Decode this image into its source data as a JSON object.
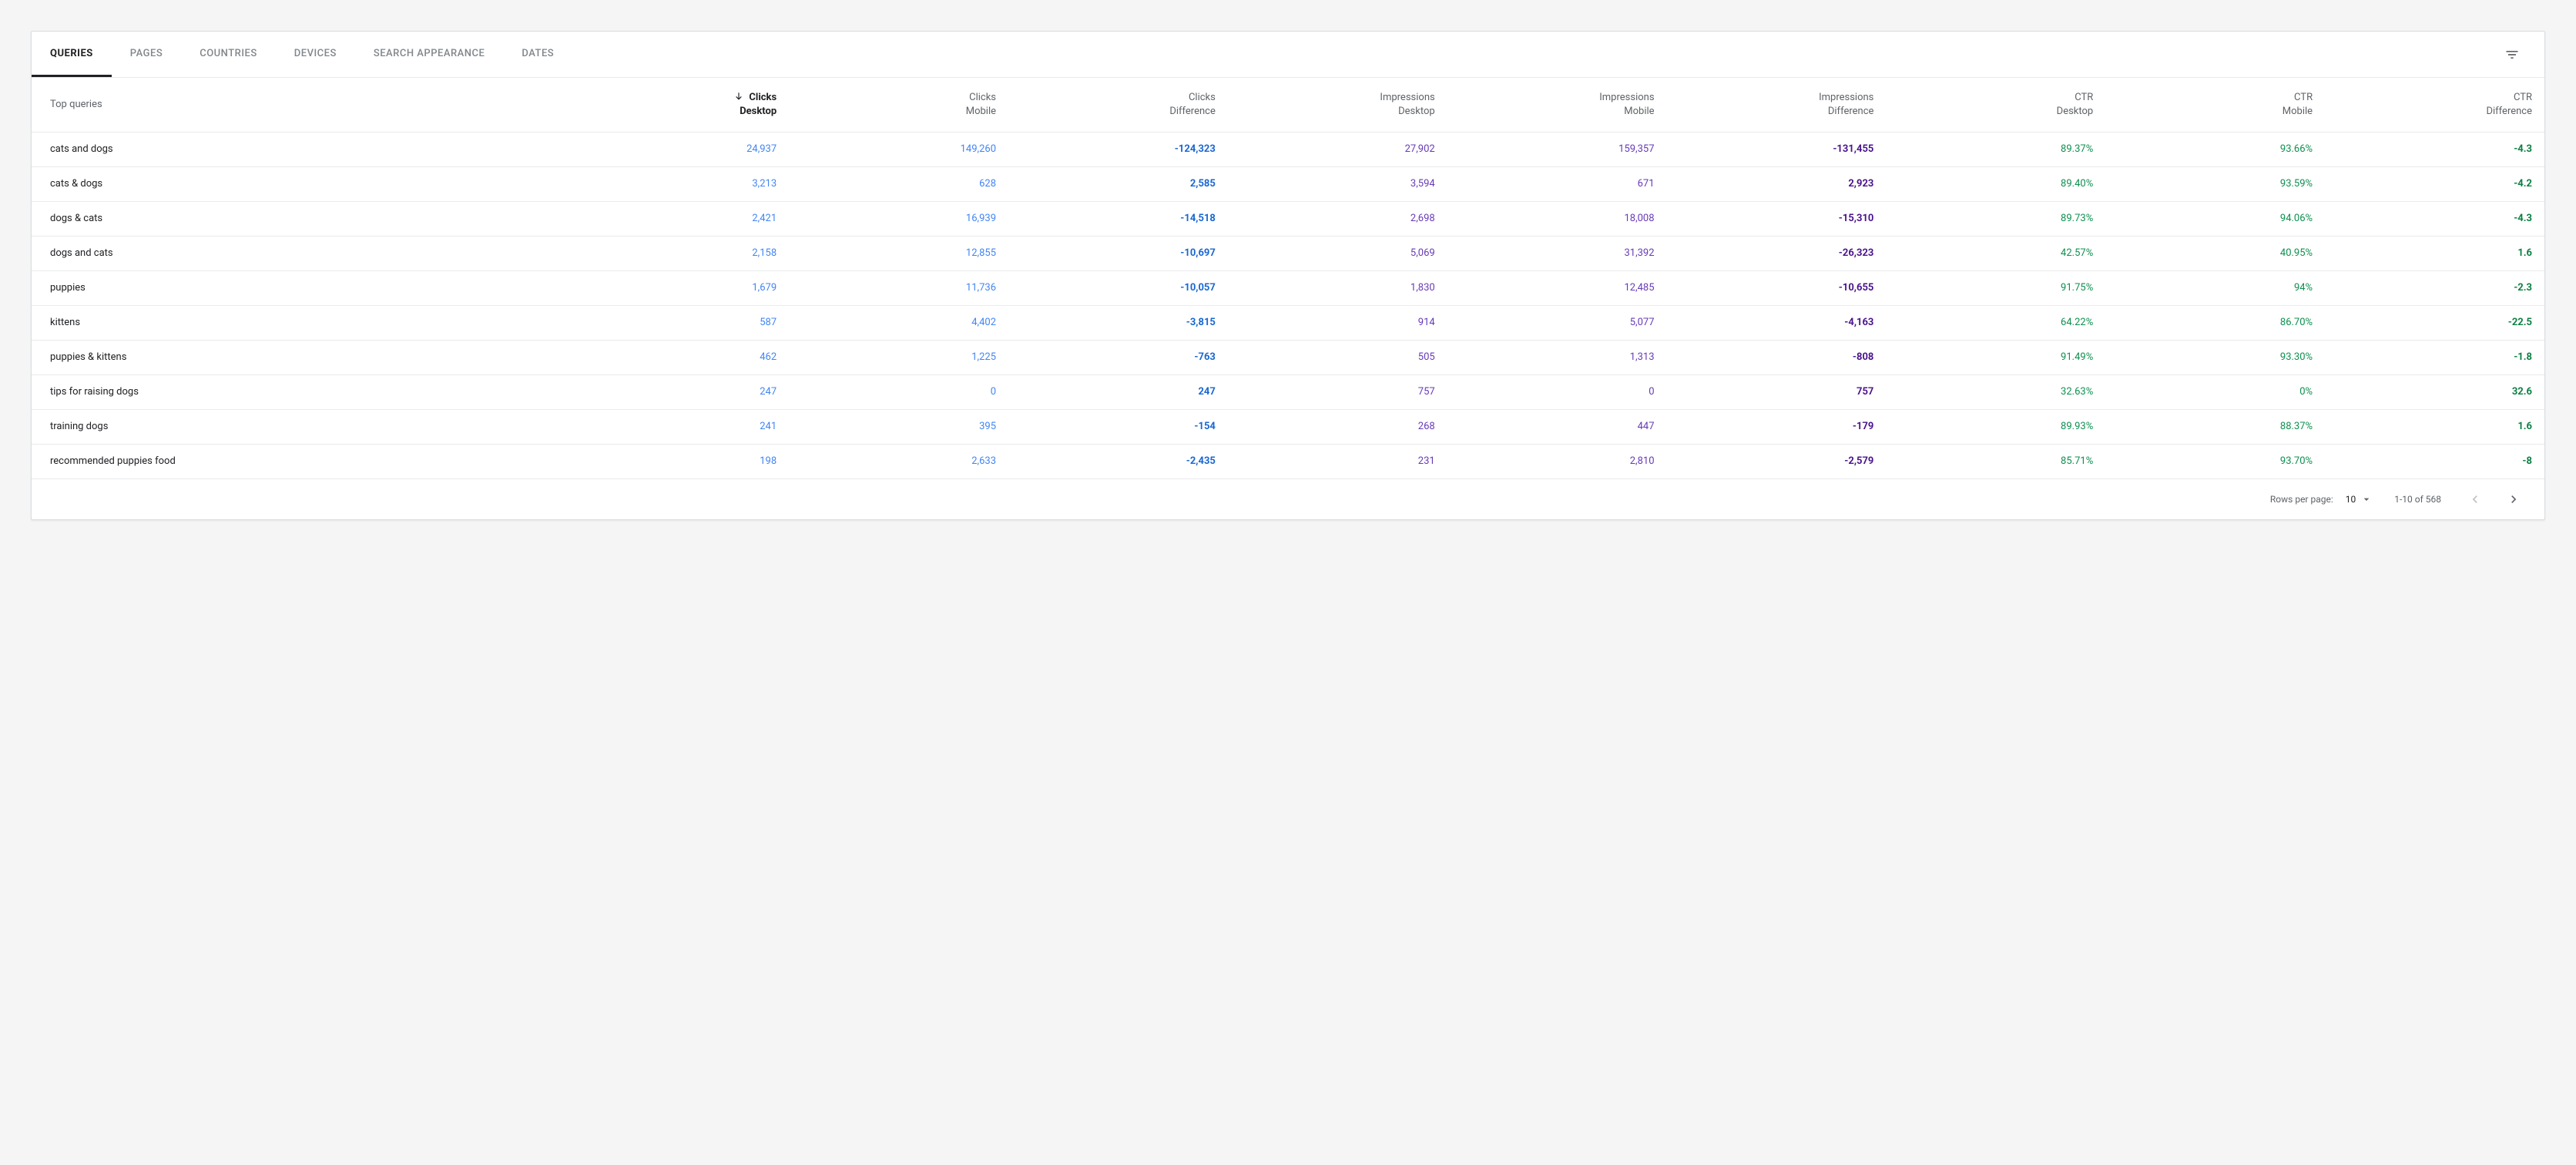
{
  "tabs": {
    "items": [
      {
        "label": "Queries"
      },
      {
        "label": "Pages"
      },
      {
        "label": "Countries"
      },
      {
        "label": "Devices"
      },
      {
        "label": "Search Appearance"
      },
      {
        "label": "Dates"
      }
    ],
    "active_index": 0
  },
  "table": {
    "query_header": "Top queries",
    "columns": [
      {
        "l1": "Clicks",
        "l2": "Desktop",
        "cls": "c-clicks",
        "sorted": true
      },
      {
        "l1": "Clicks",
        "l2": "Mobile",
        "cls": "c-clicks"
      },
      {
        "l1": "Clicks",
        "l2": "Difference",
        "cls": "c-clicks-diff"
      },
      {
        "l1": "Impressions",
        "l2": "Desktop",
        "cls": "c-impr"
      },
      {
        "l1": "Impressions",
        "l2": "Mobile",
        "cls": "c-impr"
      },
      {
        "l1": "Impressions",
        "l2": "Difference",
        "cls": "c-impr-diff"
      },
      {
        "l1": "CTR",
        "l2": "Desktop",
        "cls": "c-ctr"
      },
      {
        "l1": "CTR",
        "l2": "Mobile",
        "cls": "c-ctr"
      },
      {
        "l1": "CTR",
        "l2": "Difference",
        "cls": "c-ctr-diff"
      }
    ],
    "rows": [
      {
        "q": "cats and dogs",
        "v": [
          "24,937",
          "149,260",
          "-124,323",
          "27,902",
          "159,357",
          "-131,455",
          "89.37%",
          "93.66%",
          "-4.3"
        ]
      },
      {
        "q": "cats & dogs",
        "v": [
          "3,213",
          "628",
          "2,585",
          "3,594",
          "671",
          "2,923",
          "89.40%",
          "93.59%",
          "-4.2"
        ]
      },
      {
        "q": "dogs & cats",
        "v": [
          "2,421",
          "16,939",
          "-14,518",
          "2,698",
          "18,008",
          "-15,310",
          "89.73%",
          "94.06%",
          "-4.3"
        ]
      },
      {
        "q": "dogs and cats",
        "v": [
          "2,158",
          "12,855",
          "-10,697",
          "5,069",
          "31,392",
          "-26,323",
          "42.57%",
          "40.95%",
          "1.6"
        ]
      },
      {
        "q": "puppies",
        "v": [
          "1,679",
          "11,736",
          "-10,057",
          "1,830",
          "12,485",
          "-10,655",
          "91.75%",
          "94%",
          "-2.3"
        ]
      },
      {
        "q": "kittens",
        "v": [
          "587",
          "4,402",
          "-3,815",
          "914",
          "5,077",
          "-4,163",
          "64.22%",
          "86.70%",
          "-22.5"
        ]
      },
      {
        "q": "puppies & kittens",
        "v": [
          "462",
          "1,225",
          "-763",
          "505",
          "1,313",
          "-808",
          "91.49%",
          "93.30%",
          "-1.8"
        ]
      },
      {
        "q": "tips for raising dogs",
        "v": [
          "247",
          "0",
          "247",
          "757",
          "0",
          "757",
          "32.63%",
          "0%",
          "32.6"
        ]
      },
      {
        "q": "training dogs",
        "v": [
          "241",
          "395",
          "-154",
          "268",
          "447",
          "-179",
          "89.93%",
          "88.37%",
          "1.6"
        ]
      },
      {
        "q": "recommended puppies food",
        "v": [
          "198",
          "2,633",
          "-2,435",
          "231",
          "2,810",
          "-2,579",
          "85.71%",
          "93.70%",
          "-8"
        ]
      }
    ]
  },
  "footer": {
    "rows_per_page_label": "Rows per page:",
    "rows_per_page_value": "10",
    "range_text": "1-10 of 568"
  }
}
